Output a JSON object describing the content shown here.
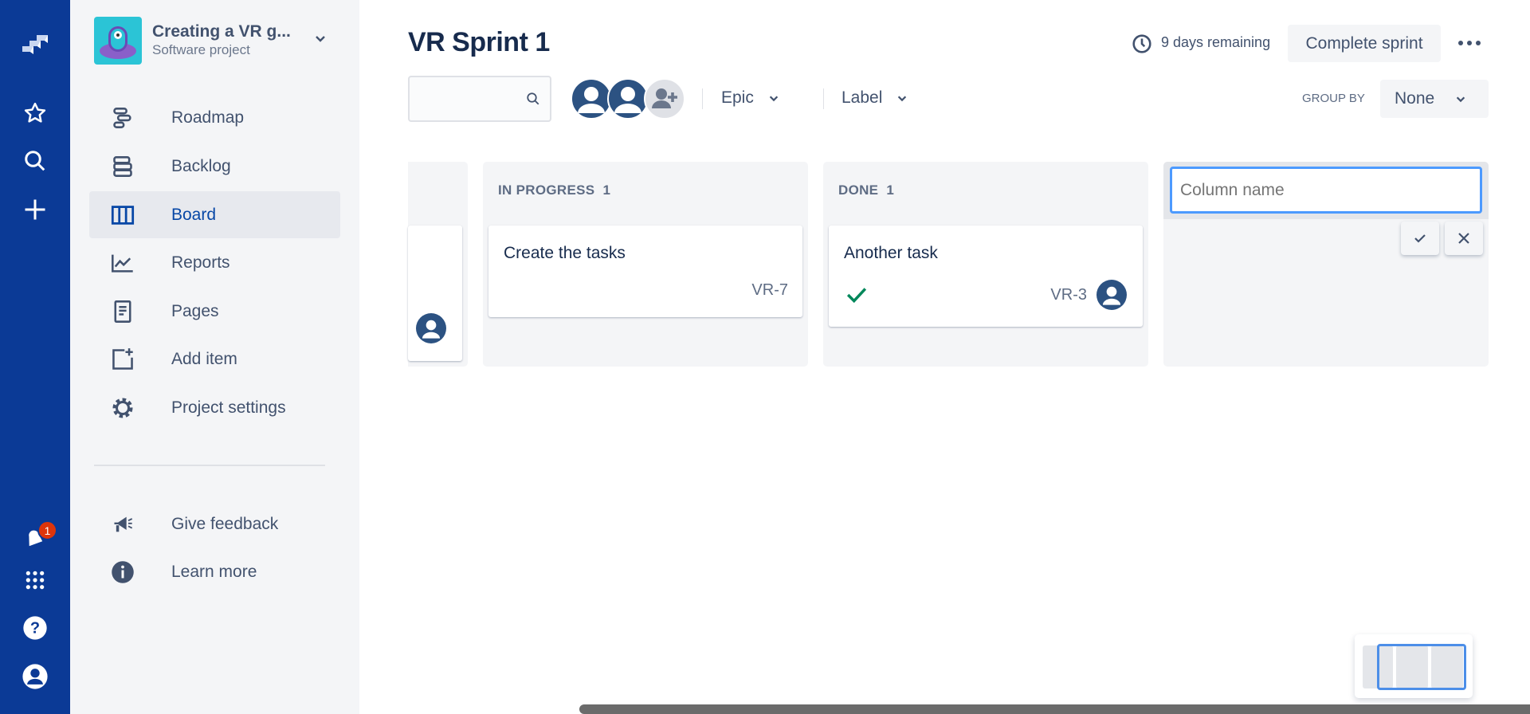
{
  "global_nav": {
    "notification_count": "1"
  },
  "project": {
    "name": "Creating a VR g...",
    "type": "Software project"
  },
  "sidebar": {
    "items": [
      {
        "label": "Roadmap"
      },
      {
        "label": "Backlog"
      },
      {
        "label": "Board",
        "active": true
      },
      {
        "label": "Reports"
      },
      {
        "label": "Pages"
      },
      {
        "label": "Add item"
      },
      {
        "label": "Project settings"
      }
    ],
    "footer": [
      {
        "label": "Give feedback"
      },
      {
        "label": "Learn more"
      }
    ]
  },
  "header": {
    "title": "VR Sprint 1",
    "remaining": "9 days remaining",
    "complete_label": "Complete sprint"
  },
  "filters": {
    "search_value": "",
    "epic": "Epic",
    "label": "Label",
    "group_by_label": "GROUP BY",
    "group_by_value": "None"
  },
  "columns": [
    {
      "title": "IN PROGRESS",
      "count": "1",
      "cards": [
        {
          "title": "Create the tasks",
          "key": "VR-7"
        }
      ]
    },
    {
      "title": "DONE",
      "count": "1",
      "cards": [
        {
          "title": "Another task",
          "key": "VR-3"
        }
      ]
    }
  ],
  "new_column": {
    "placeholder": "Column name",
    "value": ""
  },
  "colors": {
    "nav": "#0b3a96",
    "accent": "#0052cc",
    "done_check": "#00875a",
    "badge": "#de350b"
  }
}
